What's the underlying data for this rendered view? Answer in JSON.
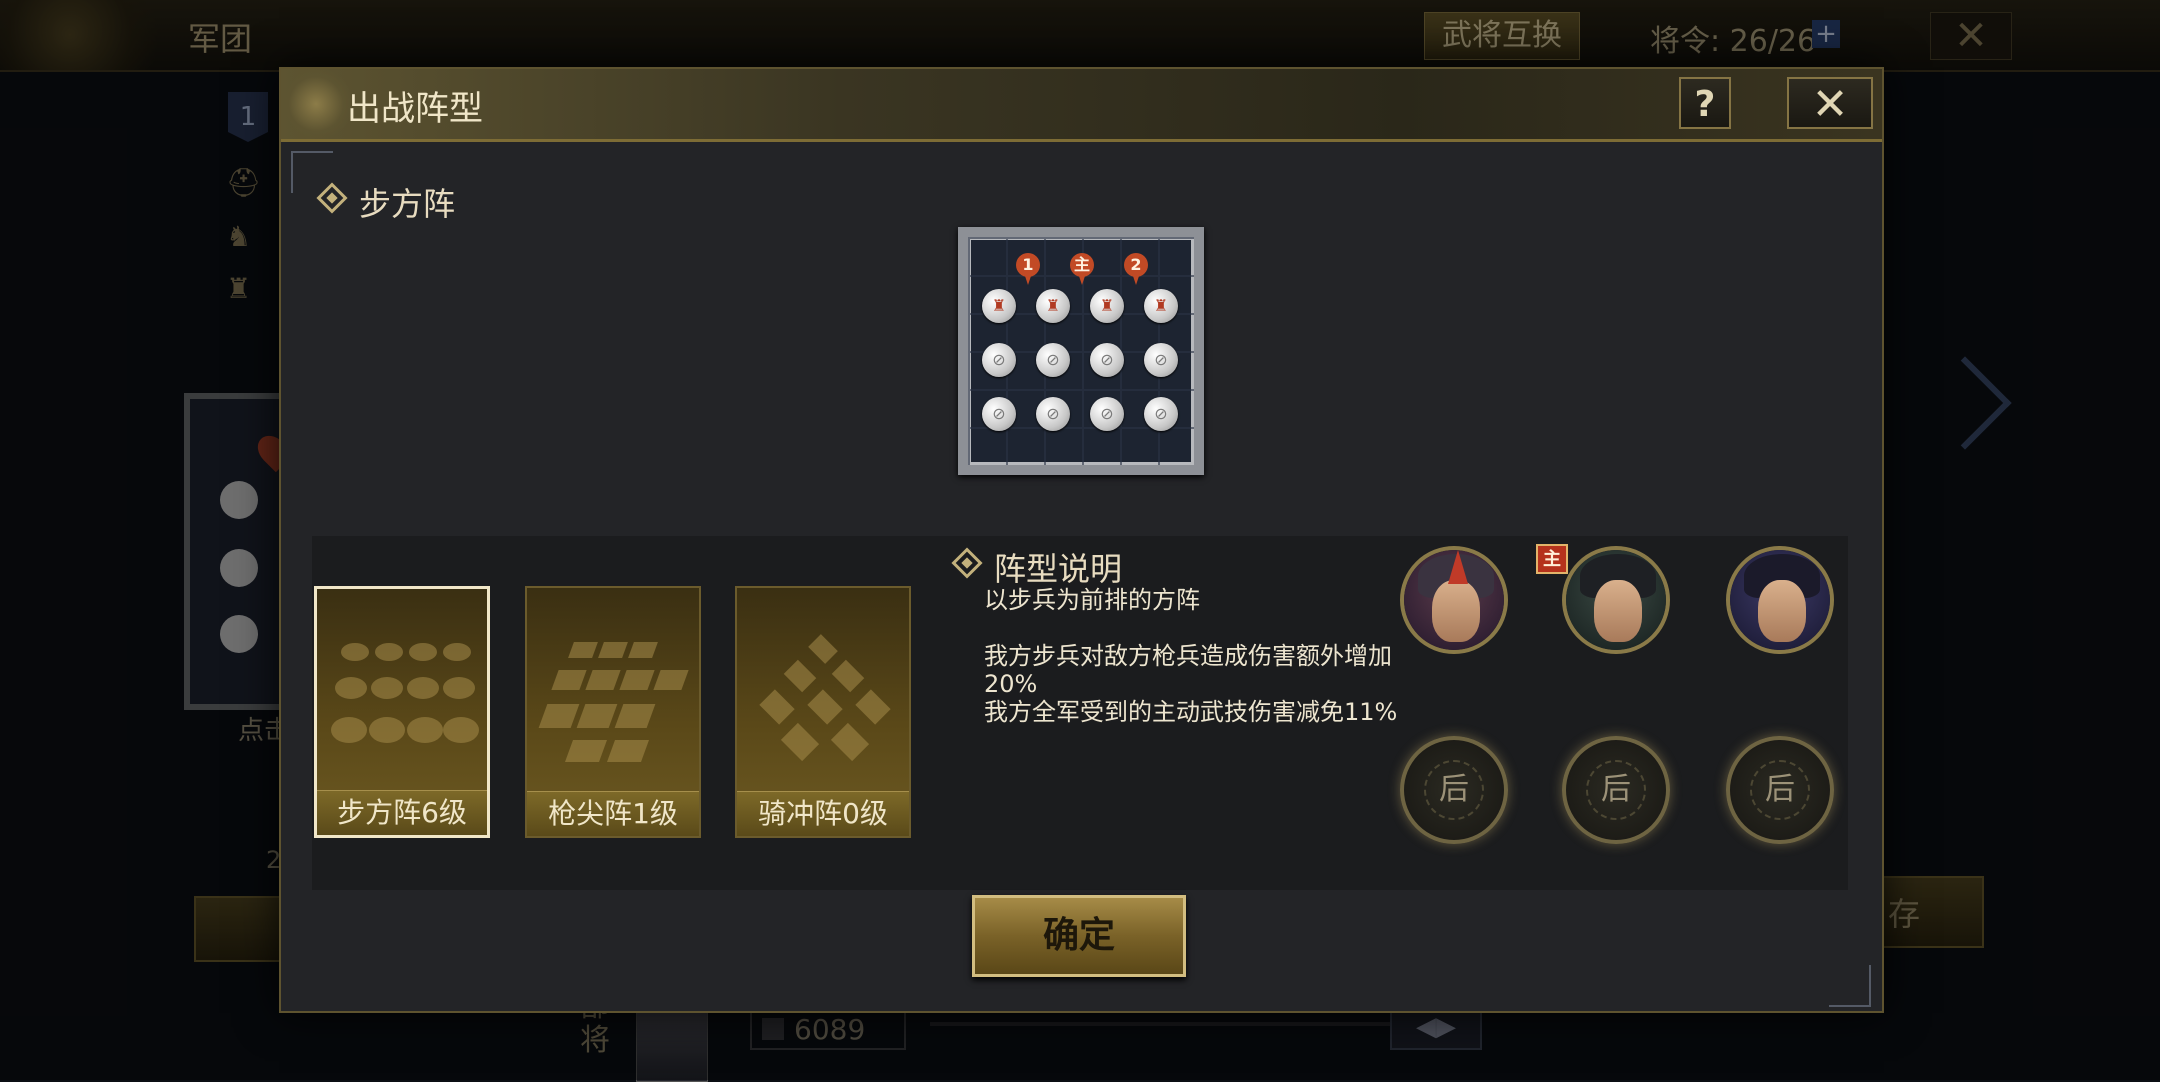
{
  "background": {
    "title": "军团",
    "swap_button": "武将互换",
    "orders": "将令: 26/26",
    "orders_plus": "+",
    "close": "✕",
    "badge": "1",
    "hint": "点击",
    "num2": "2",
    "save_partial": "存",
    "bottom_label": "部\n将",
    "power": "6089"
  },
  "dialog": {
    "title": "出战阵型",
    "help": "?",
    "close": "✕",
    "formation_name": "步方阵",
    "board_pins": [
      "1",
      "主",
      "2"
    ],
    "formations": [
      {
        "label": "步方阵6级",
        "selected": true
      },
      {
        "label": "枪尖阵1级",
        "selected": false
      },
      {
        "label": "骑冲阵0级",
        "selected": false
      }
    ],
    "description": {
      "title": "阵型说明",
      "line1": "以步兵为前排的方阵",
      "line2": "我方步兵对敌方枪兵造成伤害额外增加20%",
      "line3": "我方全军受到的主动武技伤害减免11%"
    },
    "leader_badge": "主",
    "rear_slots": [
      "后",
      "后",
      "后"
    ],
    "confirm": "确定"
  }
}
